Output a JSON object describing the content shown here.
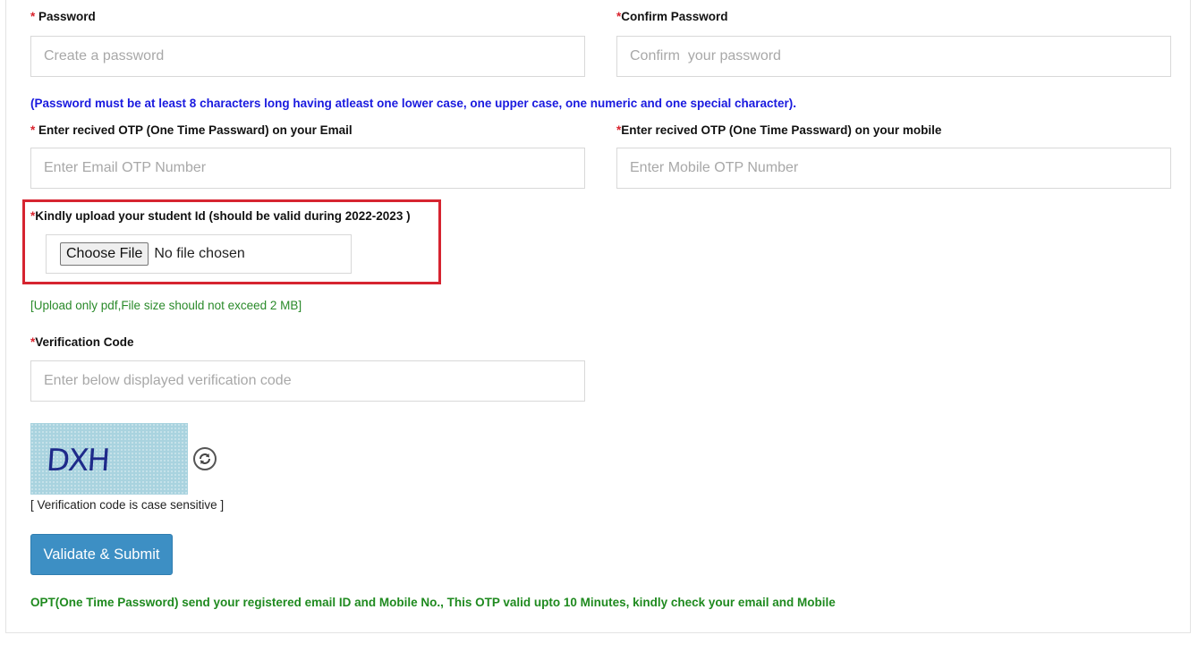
{
  "password": {
    "required_mark": "*",
    "label": " Password",
    "placeholder": "Create a password"
  },
  "confirm_password": {
    "required_mark": "*",
    "label": "Confirm Password",
    "placeholder": "Confirm  your password"
  },
  "password_rule_note": "(Password must be at least 8 characters long having atleast one lower case, one upper case, one numeric and one special character).",
  "email_otp": {
    "required_mark": "*",
    "label": " Enter recived OTP (One Time Passward) on your Email",
    "placeholder": "Enter Email OTP Number"
  },
  "mobile_otp": {
    "required_mark": "*",
    "label": "Enter recived OTP (One Time Passward) on your mobile",
    "placeholder": "Enter Mobile OTP Number"
  },
  "student_id_upload": {
    "required_mark": "*",
    "label": "Kindly upload your student Id (should be valid during 2022-2023 )",
    "button_label": "Choose File",
    "status": "No file chosen",
    "note": "[Upload only pdf,File size should not exceed 2 MB]"
  },
  "verification": {
    "required_mark": "*",
    "label": "Verification Code",
    "placeholder": "Enter below displayed verification code",
    "captcha_text": "DXH",
    "refresh_icon": "refresh-icon",
    "note": "[ Verification code is case sensitive ]"
  },
  "submit_label": "Validate & Submit",
  "otp_info_note": "OPT(One Time Password) send your registered email ID and Mobile No., This OTP valid upto 10 Minutes, kindly check your email and Mobile",
  "colors": {
    "required": "#d9232d",
    "note_blue": "#1a1adf",
    "note_green": "#1f8a1f",
    "highlight": "#d62430",
    "submit_bg": "#3d8fc4"
  }
}
